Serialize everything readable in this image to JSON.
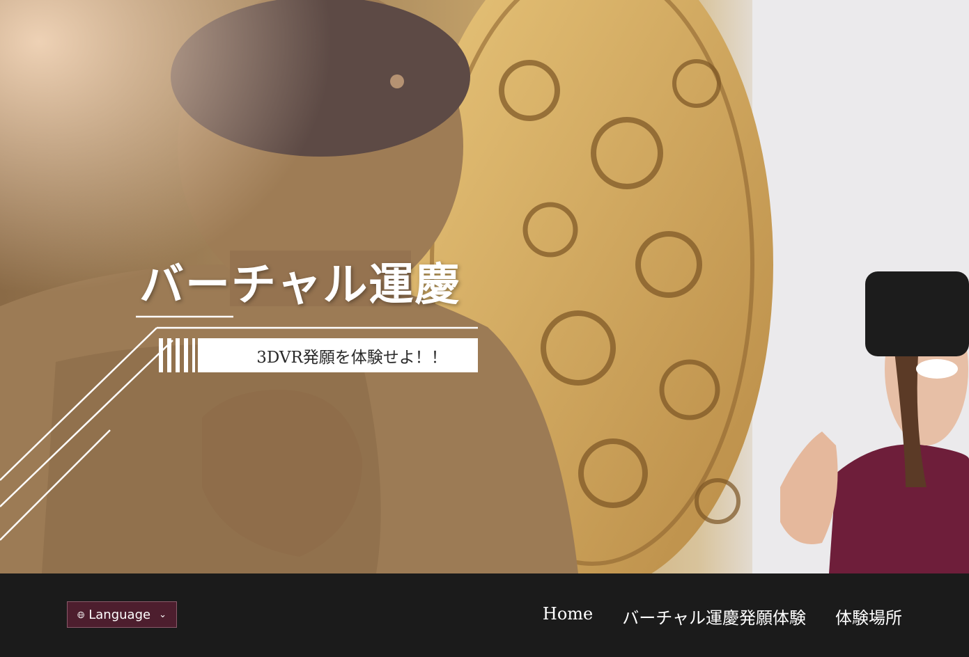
{
  "hero": {
    "title": "バーチャル運慶",
    "tagline": "3DVR発願を体験せよ！！"
  },
  "header": {
    "language_label": "Language",
    "language_icon": "globe-icon",
    "dropdown_icon": "chevron-down-icon"
  },
  "nav": {
    "items": [
      {
        "label": "Home"
      },
      {
        "label": "バーチャル運慶発願体験"
      },
      {
        "label": "体験場所"
      }
    ]
  },
  "colors": {
    "footer_bg": "#1b1b1b",
    "language_button_bg": "#4d1e2e",
    "text": "#ffffff"
  }
}
